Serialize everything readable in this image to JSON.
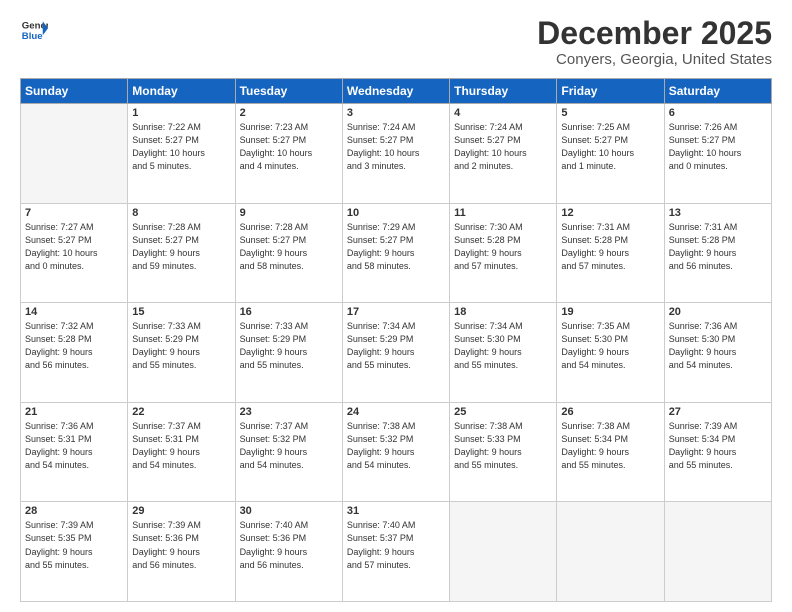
{
  "header": {
    "logo_general": "General",
    "logo_blue": "Blue",
    "main_title": "December 2025",
    "subtitle": "Conyers, Georgia, United States"
  },
  "calendar": {
    "days_of_week": [
      "Sunday",
      "Monday",
      "Tuesday",
      "Wednesday",
      "Thursday",
      "Friday",
      "Saturday"
    ],
    "weeks": [
      [
        {
          "day": "",
          "info": ""
        },
        {
          "day": "1",
          "info": "Sunrise: 7:22 AM\nSunset: 5:27 PM\nDaylight: 10 hours\nand 5 minutes."
        },
        {
          "day": "2",
          "info": "Sunrise: 7:23 AM\nSunset: 5:27 PM\nDaylight: 10 hours\nand 4 minutes."
        },
        {
          "day": "3",
          "info": "Sunrise: 7:24 AM\nSunset: 5:27 PM\nDaylight: 10 hours\nand 3 minutes."
        },
        {
          "day": "4",
          "info": "Sunrise: 7:24 AM\nSunset: 5:27 PM\nDaylight: 10 hours\nand 2 minutes."
        },
        {
          "day": "5",
          "info": "Sunrise: 7:25 AM\nSunset: 5:27 PM\nDaylight: 10 hours\nand 1 minute."
        },
        {
          "day": "6",
          "info": "Sunrise: 7:26 AM\nSunset: 5:27 PM\nDaylight: 10 hours\nand 0 minutes."
        }
      ],
      [
        {
          "day": "7",
          "info": "Sunrise: 7:27 AM\nSunset: 5:27 PM\nDaylight: 10 hours\nand 0 minutes."
        },
        {
          "day": "8",
          "info": "Sunrise: 7:28 AM\nSunset: 5:27 PM\nDaylight: 9 hours\nand 59 minutes."
        },
        {
          "day": "9",
          "info": "Sunrise: 7:28 AM\nSunset: 5:27 PM\nDaylight: 9 hours\nand 58 minutes."
        },
        {
          "day": "10",
          "info": "Sunrise: 7:29 AM\nSunset: 5:27 PM\nDaylight: 9 hours\nand 58 minutes."
        },
        {
          "day": "11",
          "info": "Sunrise: 7:30 AM\nSunset: 5:28 PM\nDaylight: 9 hours\nand 57 minutes."
        },
        {
          "day": "12",
          "info": "Sunrise: 7:31 AM\nSunset: 5:28 PM\nDaylight: 9 hours\nand 57 minutes."
        },
        {
          "day": "13",
          "info": "Sunrise: 7:31 AM\nSunset: 5:28 PM\nDaylight: 9 hours\nand 56 minutes."
        }
      ],
      [
        {
          "day": "14",
          "info": "Sunrise: 7:32 AM\nSunset: 5:28 PM\nDaylight: 9 hours\nand 56 minutes."
        },
        {
          "day": "15",
          "info": "Sunrise: 7:33 AM\nSunset: 5:29 PM\nDaylight: 9 hours\nand 55 minutes."
        },
        {
          "day": "16",
          "info": "Sunrise: 7:33 AM\nSunset: 5:29 PM\nDaylight: 9 hours\nand 55 minutes."
        },
        {
          "day": "17",
          "info": "Sunrise: 7:34 AM\nSunset: 5:29 PM\nDaylight: 9 hours\nand 55 minutes."
        },
        {
          "day": "18",
          "info": "Sunrise: 7:34 AM\nSunset: 5:30 PM\nDaylight: 9 hours\nand 55 minutes."
        },
        {
          "day": "19",
          "info": "Sunrise: 7:35 AM\nSunset: 5:30 PM\nDaylight: 9 hours\nand 54 minutes."
        },
        {
          "day": "20",
          "info": "Sunrise: 7:36 AM\nSunset: 5:30 PM\nDaylight: 9 hours\nand 54 minutes."
        }
      ],
      [
        {
          "day": "21",
          "info": "Sunrise: 7:36 AM\nSunset: 5:31 PM\nDaylight: 9 hours\nand 54 minutes."
        },
        {
          "day": "22",
          "info": "Sunrise: 7:37 AM\nSunset: 5:31 PM\nDaylight: 9 hours\nand 54 minutes."
        },
        {
          "day": "23",
          "info": "Sunrise: 7:37 AM\nSunset: 5:32 PM\nDaylight: 9 hours\nand 54 minutes."
        },
        {
          "day": "24",
          "info": "Sunrise: 7:38 AM\nSunset: 5:32 PM\nDaylight: 9 hours\nand 54 minutes."
        },
        {
          "day": "25",
          "info": "Sunrise: 7:38 AM\nSunset: 5:33 PM\nDaylight: 9 hours\nand 55 minutes."
        },
        {
          "day": "26",
          "info": "Sunrise: 7:38 AM\nSunset: 5:34 PM\nDaylight: 9 hours\nand 55 minutes."
        },
        {
          "day": "27",
          "info": "Sunrise: 7:39 AM\nSunset: 5:34 PM\nDaylight: 9 hours\nand 55 minutes."
        }
      ],
      [
        {
          "day": "28",
          "info": "Sunrise: 7:39 AM\nSunset: 5:35 PM\nDaylight: 9 hours\nand 55 minutes."
        },
        {
          "day": "29",
          "info": "Sunrise: 7:39 AM\nSunset: 5:36 PM\nDaylight: 9 hours\nand 56 minutes."
        },
        {
          "day": "30",
          "info": "Sunrise: 7:40 AM\nSunset: 5:36 PM\nDaylight: 9 hours\nand 56 minutes."
        },
        {
          "day": "31",
          "info": "Sunrise: 7:40 AM\nSunset: 5:37 PM\nDaylight: 9 hours\nand 57 minutes."
        },
        {
          "day": "",
          "info": ""
        },
        {
          "day": "",
          "info": ""
        },
        {
          "day": "",
          "info": ""
        }
      ]
    ]
  }
}
